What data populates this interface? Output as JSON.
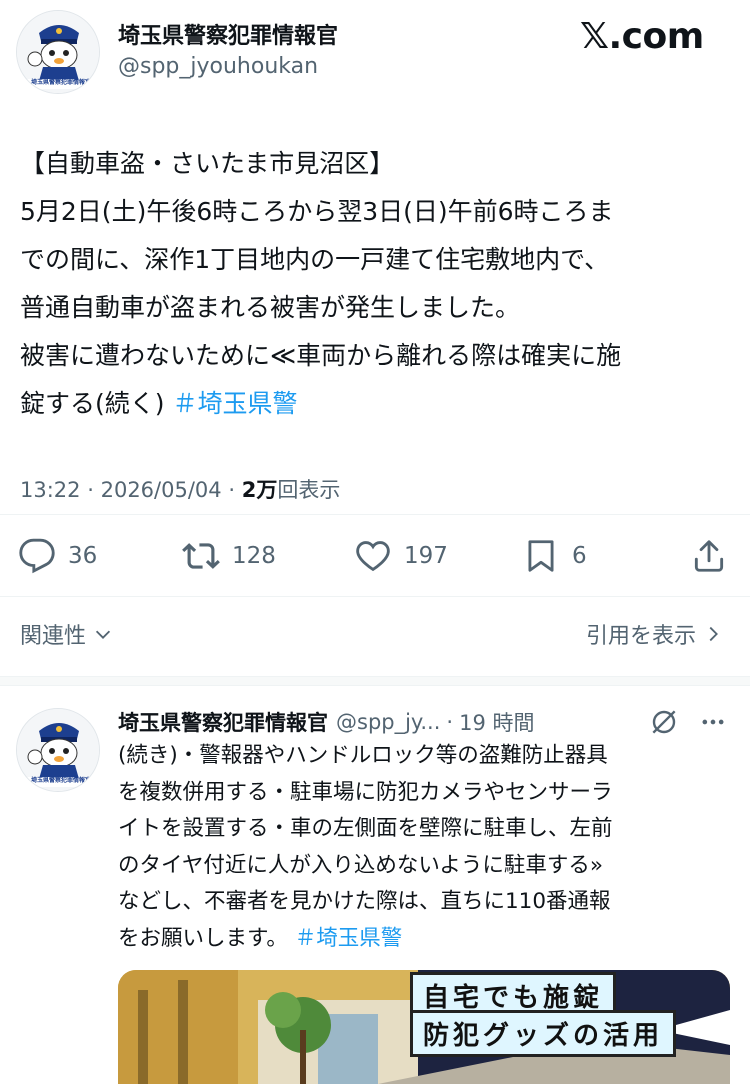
{
  "author": {
    "name": "埼玉県警察犯罪情報官",
    "handle": "@spp_jyouhoukan",
    "avatar_caption": "埼玉県警察犯罪情報官"
  },
  "brand": {
    "logo_text": "𝕏.com"
  },
  "tweet": {
    "lines": [
      "【自動車盗・さいたま市見沼区】",
      "5月2日(土)午後6時ころから翌3日(日)午前6時ころま",
      "での間に、深作1丁目地内の一戸建て住宅敷地内で、",
      "普通自動車が盗まれる被害が発生しました。",
      "被害に遭わないために≪車両から離れる際は確実に施",
      "錠する(続く)"
    ],
    "hashtag": "＃埼玉県警",
    "time": "13:22",
    "date": "2026/05/04",
    "separator": "·",
    "views_count": "2万",
    "views_label": "回表示"
  },
  "actions": {
    "replies": "36",
    "reposts": "128",
    "likes": "197",
    "bookmarks": "6"
  },
  "nav": {
    "related_label": "関連性",
    "quotes_label": "引用を表示"
  },
  "reply": {
    "name": "埼玉県警察犯罪情報官",
    "handle": "@spp_jy...",
    "separator": "·",
    "time": "19 時間",
    "lines": [
      "(続き)・警報器やハンドルロック等の盗難防止器具",
      "を複数併用する・駐車場に防犯カメラやセンサーラ",
      "イトを設置する・車の左側面を壁際に駐車し、左前",
      "のタイヤ付近に人が入り込めないように駐車する»",
      "などし、不審者を見かけた際は、直ちに110番通報",
      "をお願いします。"
    ],
    "hashtag": "＃埼玉県警",
    "media_text_1": "自宅でも施錠",
    "media_text_2": "防犯グッズの活用"
  },
  "colors": {
    "text": "#0f1419",
    "secondary": "#536471",
    "link": "#1d9bf0"
  }
}
